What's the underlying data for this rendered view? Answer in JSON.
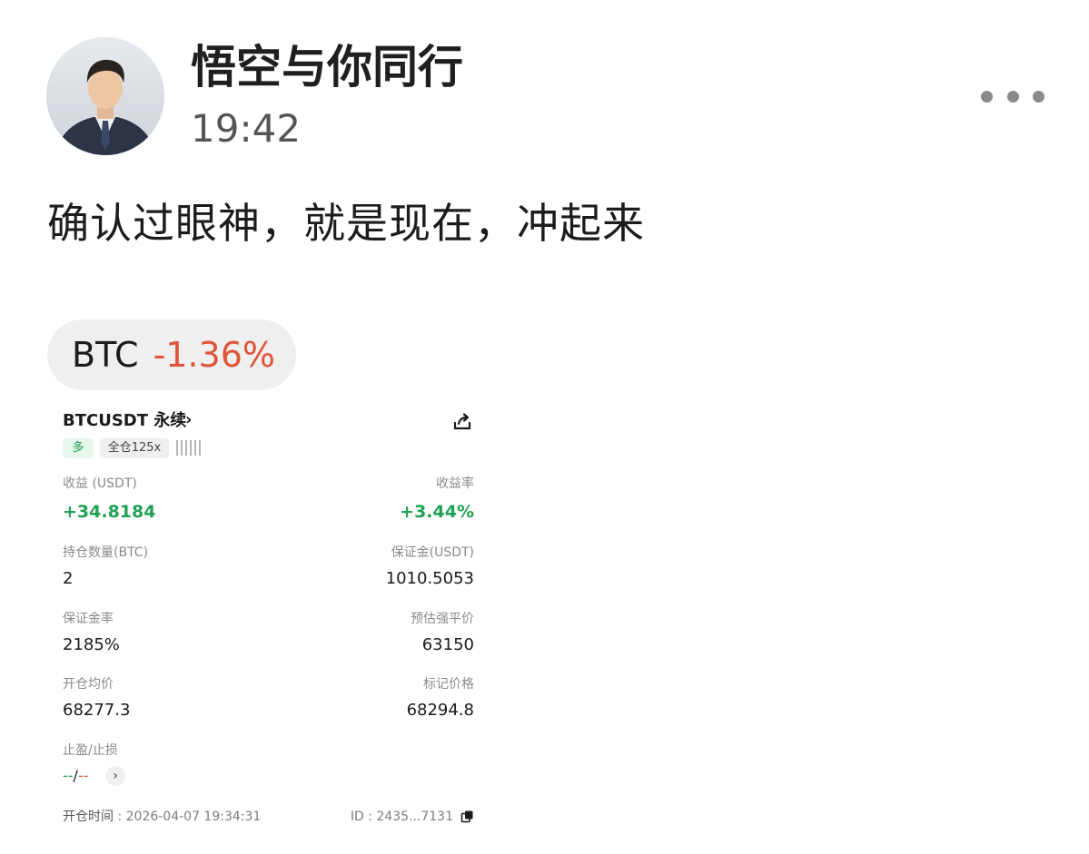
{
  "post": {
    "username": "悟空与你同行",
    "time": "19:42",
    "text": "确认过眼神，就是现在，冲起来",
    "ticker": {
      "symbol": "BTC",
      "change": "-1.36%",
      "change_color": "#e0543a"
    },
    "more_icon": "more-dots-icon"
  },
  "position": {
    "pair": "BTCUSDT 永续",
    "pair_chevron": "›",
    "side_badge": "多",
    "margin_badge": "全仓125x",
    "share_icon": "share-icon",
    "pnl_label": "收益 (USDT)",
    "pnl_value": "+34.8184",
    "roe_label": "收益率",
    "roe_value": "+3.44%",
    "size_label": "持仓数量(BTC)",
    "size_value": "2",
    "margin_label": "保证金(USDT)",
    "margin_value": "1010.5053",
    "margin_ratio_label": "保证金率",
    "margin_ratio_value": "2185%",
    "liq_label": "预估强平价",
    "liq_value": "63150",
    "entry_label": "开仓均价",
    "entry_value": "68277.3",
    "mark_label": "标记价格",
    "mark_value": "68294.8",
    "tpsl_label": "止盈/止损",
    "tp_value": "--",
    "tpsl_sep": "/",
    "sl_value": "--",
    "tpsl_chevron": "›",
    "open_time_label": "开仓时间",
    "open_time_value": "2026-04-07 19:34:31",
    "id_label": "ID",
    "id_value": "2435...7131",
    "positive_color": "#21a152"
  }
}
